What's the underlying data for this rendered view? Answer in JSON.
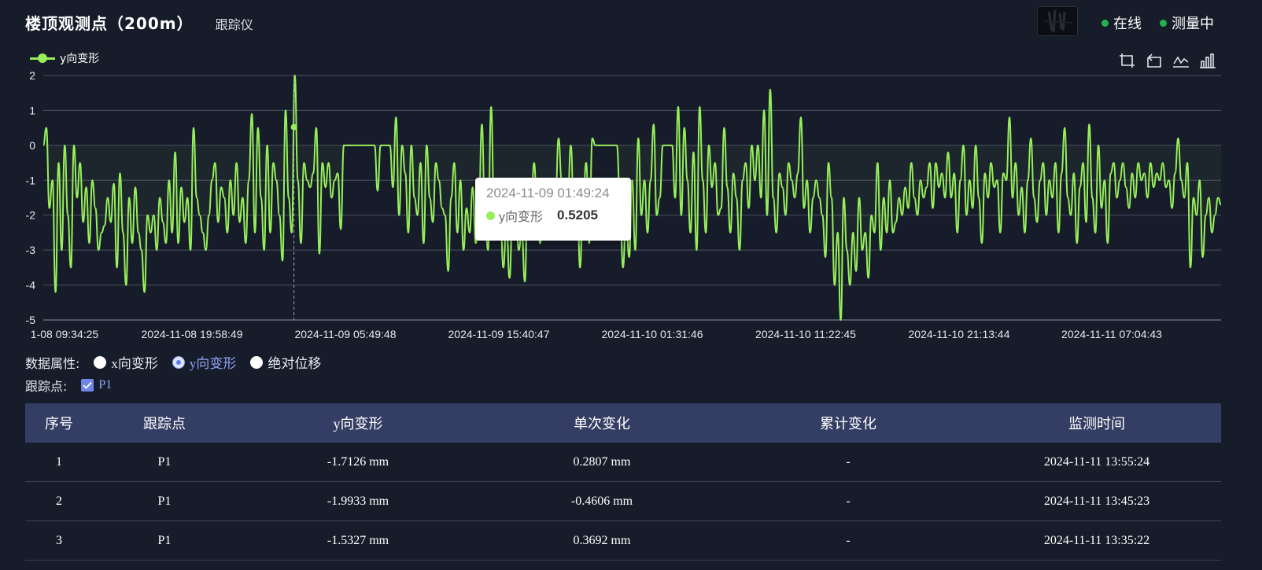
{
  "header": {
    "title": "楼顶观测点（200m）",
    "subtitle": "跟踪仪",
    "status_online": "在线",
    "status_measuring": "测量中"
  },
  "legend": {
    "series_name": "y向变形"
  },
  "toolbox": [
    "zoom-select-icon",
    "zoom-reset-icon",
    "line-chart-icon",
    "bar-chart-icon"
  ],
  "tooltip": {
    "time": "2024-11-09 01:49:24",
    "series": "y向变形",
    "value": "0.5205"
  },
  "attributes": {
    "label": "数据属性:",
    "options": [
      "x向变形",
      "y向变形",
      "绝对位移"
    ],
    "selected": "y向变形"
  },
  "tracking": {
    "label": "跟踪点:",
    "point": "P1",
    "checked": true
  },
  "table": {
    "headers": [
      "序号",
      "跟踪点",
      "y向变形",
      "单次变化",
      "累计变化",
      "监测时间"
    ],
    "rows": [
      [
        "1",
        "P1",
        "-1.7126 mm",
        "0.2807 mm",
        "-",
        "2024-11-11 13:55:24"
      ],
      [
        "2",
        "P1",
        "-1.9933 mm",
        "-0.4606 mm",
        "-",
        "2024-11-11 13:45:23"
      ],
      [
        "3",
        "P1",
        "-1.5327 mm",
        "0.3692 mm",
        "-",
        "2024-11-11 13:35:22"
      ]
    ]
  },
  "colors": {
    "series": "#96ef5a",
    "status": "#22b14c",
    "header_bg": "#343d63",
    "background": "#171c2a"
  },
  "chart_data": {
    "type": "line",
    "title": "",
    "xlabel": "",
    "ylabel": "",
    "ylim": [
      -5,
      2
    ],
    "yticks": [
      2,
      1,
      0,
      -1,
      -2,
      -3,
      -4,
      -5
    ],
    "xticks": [
      "1-08 09:34:25",
      "2024-11-08 19:58:49",
      "2024-11-09 05:49:48",
      "2024-11-09 15:40:47",
      "2024-11-10 01:31:46",
      "2024-11-10 11:22:45",
      "2024-11-10 21:13:44",
      "2024-11-11 07:04:43"
    ],
    "grid": true,
    "legend_position": "top-left",
    "highlight": {
      "x": "2024-11-09 01:49:24",
      "y": 0.5205
    },
    "series": [
      {
        "name": "y向变形",
        "color": "#96ef5a",
        "x_start": "2024-11-08 09:34:25",
        "x_end": "2024-11-11 13:55:24",
        "values": [
          0,
          0.5,
          -1.8,
          -1.0,
          -4.2,
          -0.5,
          -3.0,
          0.0,
          -2.0,
          -3.5,
          0.0,
          -1.5,
          -0.5,
          -2.2,
          -1.2,
          -2.8,
          -1.0,
          -1.8,
          -3.0,
          -2.5,
          -2.3,
          -1.5,
          -2.2,
          -1.1,
          -3.5,
          -0.8,
          -2.5,
          -4.0,
          -1.5,
          -2.8,
          -1.2,
          -2.5,
          -3.0,
          -4.2,
          -2.0,
          -2.5,
          -2.0,
          -3.0,
          -1.5,
          -2.2,
          -2.8,
          -1.0,
          -2.5,
          -0.2,
          -2.8,
          -1.2,
          -2.2,
          -1.5,
          -3.0,
          0.5,
          -1.5,
          -2.0,
          -2.5,
          -3.0,
          -2.0,
          -1.0,
          -0.5,
          -2.2,
          -1.2,
          -1.5,
          -2.5,
          -1.0,
          -2.0,
          -0.5,
          -2.2,
          -1.5,
          -2.8,
          -1.0,
          0.9,
          -2.5,
          0.5,
          -1.5,
          -3.0,
          0.0,
          -2.5,
          -0.5,
          -1.0,
          -2.0,
          -3.3,
          1.0,
          -1.5,
          -2.5,
          2.0,
          -1.0,
          -2.8,
          -0.5,
          -1.0,
          -1.2,
          -0.8,
          0.5,
          -3.1,
          -0.5,
          -1.2,
          -0.5,
          -1.5,
          -1.0,
          -0.8,
          -2.4,
          0.0,
          0.0,
          0.0,
          0.0,
          0.0,
          0.0,
          0.0,
          0.0,
          0.0,
          0.0,
          0.0,
          -1.3,
          0.0,
          0.0,
          0.0,
          0.0,
          -1.2,
          0.8,
          -2.0,
          0.0,
          -0.8,
          -2.5,
          0.0,
          -1.5,
          -2.0,
          -0.5,
          -2.8,
          0.0,
          -1.5,
          -2.2,
          -0.5,
          -1.0,
          -1.8,
          -2.0,
          -3.6,
          -1.5,
          -0.5,
          -2.5,
          -1.0,
          -3.0,
          -1.8,
          -2.5,
          -1.2,
          -2.8,
          -1.8,
          0.6,
          -2.0,
          -3.0,
          1.1,
          -1.8,
          -2.5,
          -2.0,
          -3.5,
          -2.2,
          -3.8,
          -2.0,
          -1.5,
          -3.0,
          -2.5,
          -3.9,
          -1.0,
          -2.0,
          -0.5,
          -1.8,
          -2.8,
          -1.5,
          -2.7,
          -1.0,
          -2.0,
          -1.5,
          0.2,
          -1.0,
          -2.5,
          -1.5,
          0.0,
          -2.0,
          -1.0,
          -3.5,
          -1.5,
          -0.5,
          -2.8,
          0.2,
          0.0,
          0.0,
          0.0,
          0.0,
          0.0,
          0.0,
          0.0,
          0.0,
          -1.5,
          -3.5,
          -2.0,
          -3.2,
          -1.0,
          -3.0,
          0.2,
          -2.0,
          -1.0,
          -2.5,
          -1.0,
          0.6,
          -2.0,
          -1.5,
          0.0,
          0.0,
          0.0,
          0.0,
          -1.5,
          1.1,
          -2.0,
          0.5,
          -1.0,
          -2.5,
          -0.2,
          -3.0,
          1.1,
          -1.0,
          -2.5,
          0.0,
          -1.2,
          -0.5,
          -2.0,
          -1.8,
          0.5,
          -1.2,
          -2.5,
          -0.8,
          -1.5,
          -3.0,
          -1.0,
          -0.5,
          -1.8,
          0.0,
          -1.0,
          0.0,
          -1.5,
          1.0,
          -2.0,
          1.6,
          -1.5,
          -2.5,
          -0.8,
          -1.2,
          -2.0,
          -0.5,
          -1.0,
          -1.5,
          -0.8,
          0.8,
          -1.8,
          -1.0,
          -2.5,
          -1.5,
          -1.0,
          -1.5,
          -2.0,
          -3.2,
          -0.5,
          -1.5,
          -4.0,
          -2.5,
          -5.0,
          -1.5,
          -3.0,
          -4.0,
          -2.5,
          -3.6,
          -1.5,
          -3.0,
          -2.5,
          -3.8,
          -2.0,
          -2.5,
          -0.5,
          -3.0,
          -1.5,
          -2.5,
          -1.0,
          -2.5,
          -2.2,
          -1.5,
          -2.0,
          -1.2,
          -1.8,
          -0.5,
          -1.5,
          -2.0,
          -1.0,
          -1.5,
          -1.2,
          -0.5,
          -1.8,
          -0.5,
          -1.2,
          -0.8,
          -1.5,
          -0.2,
          -1.5,
          -0.8,
          -2.5,
          -1.0,
          0.0,
          -2.0,
          -1.0,
          -1.8,
          0.0,
          -1.5,
          -2.8,
          -0.8,
          -1.5,
          -0.5,
          -1.2,
          -1.0,
          -2.5,
          -0.8,
          -1.0,
          0.8,
          -1.5,
          -0.5,
          -2.0,
          -1.2,
          -2.5,
          -1.0,
          0.2,
          -1.5,
          -2.2,
          -1.0,
          -0.5,
          -2.0,
          -1.0,
          -1.5,
          -0.5,
          -2.5,
          -0.8,
          0.5,
          -1.5,
          -2.0,
          -0.8,
          -2.8,
          -1.2,
          -0.5,
          -2.2,
          0.6,
          -1.5,
          -2.5,
          0.0,
          -1.8,
          -1.0,
          -2.8,
          -0.8,
          -0.5,
          -1.5,
          -1.0,
          -0.5,
          -1.2,
          -1.8,
          -0.8,
          -1.5,
          -0.5,
          -1.0,
          -0.8,
          -1.5,
          -0.5,
          -1.2,
          -0.8,
          -1.0,
          -0.5,
          -1.2,
          -1.0,
          -1.8,
          -0.8,
          0.2,
          -1.0,
          -1.5,
          -0.5,
          -3.5,
          -1.5,
          -2.0,
          -1.0,
          -3.2,
          -2.0,
          -1.5,
          -2.5,
          -2.0,
          -1.5,
          -1.7
        ]
      }
    ]
  }
}
